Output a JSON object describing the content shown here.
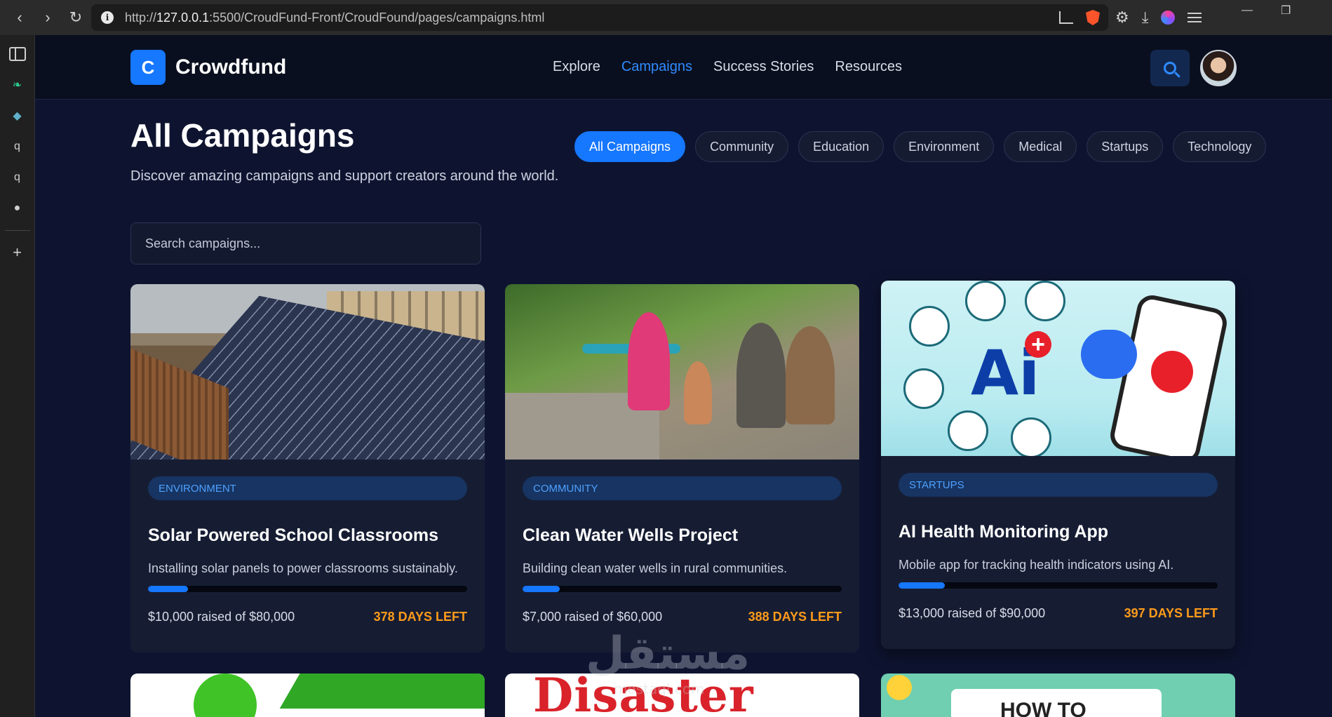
{
  "browser": {
    "url_prefix": "http://",
    "url_host": "127.0.0.1",
    "url_path": ":5500/CroudFund-Front/CroudFound/pages/campaigns.html"
  },
  "brand": {
    "logo_letter": "C",
    "name": "Crowdfund",
    "accent": "#1677ff"
  },
  "nav": {
    "items": [
      {
        "label": "Explore",
        "active": false
      },
      {
        "label": "Campaigns",
        "active": true
      },
      {
        "label": "Success Stories",
        "active": false
      },
      {
        "label": "Resources",
        "active": false
      }
    ]
  },
  "header": {
    "title": "All Campaigns",
    "subtitle": "Discover amazing campaigns and support creators around the world."
  },
  "filters": [
    {
      "label": "All Campaigns",
      "active": true
    },
    {
      "label": "Community",
      "active": false
    },
    {
      "label": "Education",
      "active": false
    },
    {
      "label": "Environment",
      "active": false
    },
    {
      "label": "Medical",
      "active": false
    },
    {
      "label": "Startups",
      "active": false
    },
    {
      "label": "Technology",
      "active": false
    }
  ],
  "search": {
    "placeholder": "Search campaigns..."
  },
  "campaigns": [
    {
      "category": "ENVIRONMENT",
      "title": "Solar Powered School Classrooms",
      "description": "Installing solar panels to power classrooms sustainably.",
      "raised_text": "$10,000 raised of $80,000",
      "raised_fraction": 0.125,
      "days_left": "378 DAYS LEFT"
    },
    {
      "category": "COMMUNITY",
      "title": "Clean Water Wells Project",
      "description": "Building clean water wells in rural communities.",
      "raised_text": "$7,000 raised of $60,000",
      "raised_fraction": 0.117,
      "days_left": "388 DAYS LEFT"
    },
    {
      "category": "STARTUPS",
      "title": "AI Health Monitoring App",
      "description": "Mobile app for tracking health indicators using AI.",
      "raised_text": "$13,000 raised of $90,000",
      "raised_fraction": 0.144,
      "days_left": "397 DAYS LEFT",
      "image_text": "Ai"
    }
  ],
  "partial_cards": {
    "disaster_text": "Disaster",
    "howto_text": "HOW TO"
  },
  "watermark": {
    "main": "مستقل",
    "sub": "mostaql.com"
  }
}
